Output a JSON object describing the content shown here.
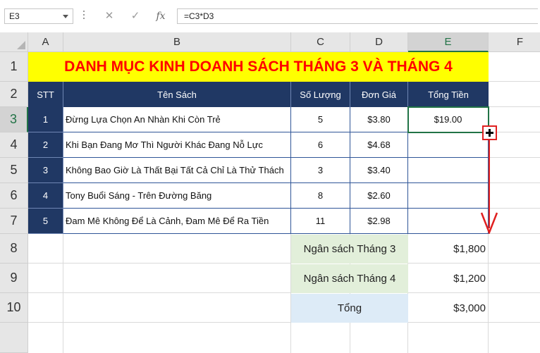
{
  "formula_bar": {
    "name_box": "E3",
    "cancel_icon": "close-icon",
    "enter_icon": "check-icon",
    "fx_label": "fx",
    "formula": "=C3*D3"
  },
  "columns": [
    "A",
    "B",
    "C",
    "D",
    "E",
    "F"
  ],
  "rows": [
    "1",
    "2",
    "3",
    "4",
    "5",
    "6",
    "7",
    "8",
    "9",
    "10"
  ],
  "selected": {
    "column": "E",
    "row": "3"
  },
  "sheet": {
    "title": "DANH MỤC KINH DOANH SÁCH THÁNG 3 VÀ THÁNG 4",
    "headers": {
      "stt": "STT",
      "name": "Tên Sách",
      "qty": "Số Lượng",
      "price": "Đơn Giá",
      "total": "Tổng Tiền"
    },
    "books": [
      {
        "stt": "1",
        "name": "Đừng Lựa Chọn An Nhàn Khi Còn Trẻ",
        "qty": "5",
        "price": "$3.80",
        "total": "$19.00"
      },
      {
        "stt": "2",
        "name": "Khi Bạn Đang Mơ Thì Người Khác Đang Nỗ Lực",
        "qty": "6",
        "price": "$4.68",
        "total": ""
      },
      {
        "stt": "3",
        "name": "Không Bao Giờ Là Thất Bại Tất Cả Chỉ Là Thử Thách",
        "qty": "3",
        "price": "$3.40",
        "total": ""
      },
      {
        "stt": "4",
        "name": "Tony Buổi Sáng - Trên Đường Băng",
        "qty": "8",
        "price": "$2.60",
        "total": ""
      },
      {
        "stt": "5",
        "name": "Đam Mê Không Để Là Cảnh, Đam Mê Để Ra Tiền",
        "qty": "11",
        "price": "$2.98",
        "total": ""
      }
    ],
    "summary": [
      {
        "label": "Ngân sách Tháng 3",
        "value": "$1,800"
      },
      {
        "label": "Ngân sách Tháng 4",
        "value": "$1,200"
      },
      {
        "label": "Tổng",
        "value": "$3,000"
      }
    ]
  },
  "colors": {
    "title_bg": "#ffff00",
    "title_text": "#ff0000",
    "header_bg": "#203864",
    "excel_green": "#217346",
    "budget_bg": "#e2efda",
    "total_bg": "#ddebf7",
    "annotation": "#e02020"
  },
  "annotation": {
    "fill_handle_icon": "crosshair-plus-icon",
    "arrow_icon": "arrow-down-icon"
  }
}
